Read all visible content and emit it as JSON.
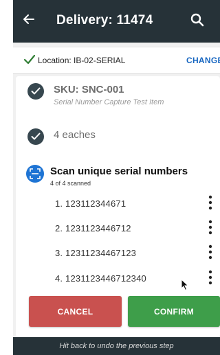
{
  "appbar": {
    "title": "Delivery: 11474",
    "back_icon": "arrow-left-icon",
    "search_icon": "search-icon"
  },
  "location": {
    "label": "Location:  IB-02-SERIAL",
    "change_label": "CHANGE",
    "check_color": "#2e7d32"
  },
  "steps": {
    "sku_title": "SKU: SNC-001",
    "sku_subtitle": "Serial Number Capture Test Item",
    "eaches": "4 eaches"
  },
  "scan": {
    "title": "Scan unique serial numbers",
    "count": "4 of 4 scanned",
    "serials": [
      "1. 123112344671",
      "2. 1231123446712",
      "3. 12311234467123",
      "4. 1231123446712340"
    ]
  },
  "actions": {
    "cancel_label": "CANCEL",
    "confirm_label": "CONFIRM"
  },
  "footer": {
    "hint": "Hit back to undo the previous step"
  },
  "colors": {
    "appbar": "#263238",
    "accent": "#1565c0",
    "cancel": "#c9514f",
    "confirm": "#3e9e4a"
  }
}
